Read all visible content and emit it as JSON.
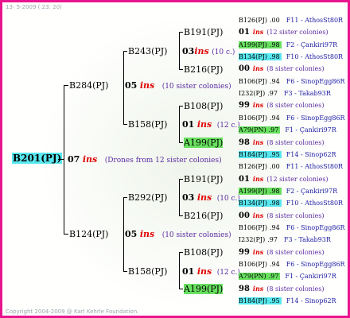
{
  "header": {
    "date": "13- 5-2009 ( 23: 20)"
  },
  "footer": {
    "copyright": "Copyright 2004-2009 @ Karl Kehrle Foundation."
  },
  "root": {
    "name": "B201(PJ)",
    "gen": "07",
    "ins": "ins",
    "note": "(Drones from 12 sister colonies)"
  },
  "upper": {
    "name": "B284(PJ)",
    "gen": "05",
    "ins": "ins",
    "note": "(10 sister colonies)",
    "top": {
      "name": "B243(PJ)",
      "gen": "03",
      "ins": "ins",
      "note": "(10 c.)",
      "a": {
        "name": "B191(PJ)",
        "gen": "01",
        "ins": "ins",
        "note": "(12 c.)"
      },
      "b": {
        "name": "B216(PJ)"
      }
    },
    "bottom": {
      "name": "B158(PJ)",
      "gen": "01",
      "ins": "ins",
      "note": "(12 c.)",
      "a": {
        "name": "B108(PJ)"
      },
      "b": {
        "name": "A199(PJ)"
      }
    }
  },
  "lower": {
    "name": "B124(PJ)",
    "gen": "05",
    "ins": "ins",
    "note": "(10 sister colonies)",
    "top": {
      "name": "B292(PJ)",
      "gen": "03",
      "ins": "ins",
      "note": "(10 c.)",
      "a": {
        "name": "B191(PJ)"
      },
      "b": {
        "name": "B216(PJ)"
      }
    },
    "bottom": {
      "name": "B158(PJ)",
      "gen": "01",
      "ins": "ins",
      "note": "(12 c.)",
      "a": {
        "name": "B108(PJ)"
      },
      "b": {
        "name": "A199(PJ)"
      }
    }
  },
  "right": [
    {
      "a": "B126(PJ)",
      "v": ".00",
      "info": "F11 - AthosSt80R"
    },
    {
      "g": "01",
      "i": "ins",
      "n": "(12 sister colonies)"
    },
    {
      "a": "A199(PJ)",
      "v": ".98",
      "info": "F2 - Çankiri97R",
      "hl": "g"
    },
    {
      "a": "B134(PJ)",
      "v": ".98",
      "info": "F10 - AthosSt80R",
      "hl": "c"
    },
    {
      "g": "00",
      "i": "ins",
      "n": "(8 sister colonies)"
    },
    {
      "a": "B106(PJ)",
      "v": ".94",
      "info": "F6 - SinopEgg86R"
    },
    {
      "a": "I232(PJ)",
      "v": ".97",
      "info": "F3 - Takab93R"
    },
    {
      "g": "99",
      "i": "ins",
      "n": "(8 sister colonies)"
    },
    {
      "a": "B106(PJ)",
      "v": ".94",
      "info": "F6 - SinopEgg86R"
    },
    {
      "a": "A79(PN)",
      "v": ".97",
      "info": "F1 - Çankiri97R",
      "hl": "g"
    },
    {
      "g": "98",
      "i": "ins",
      "n": "(8 sister colonies)"
    },
    {
      "a": "B184(PJ)",
      "v": ".95",
      "info": "F14 - Sinop62R",
      "hl": "c"
    },
    {
      "a": "B126(PJ)",
      "v": ".00",
      "info": "F11 - AthosSt80R"
    },
    {
      "g": "01",
      "i": "ins",
      "n": "(12 sister colonies)"
    },
    {
      "a": "A199(PJ)",
      "v": ".98",
      "info": "F2 - Çankiri97R",
      "hl": "g"
    },
    {
      "a": "B134(PJ)",
      "v": ".98",
      "info": "F10 - AthosSt80R",
      "hl": "c"
    },
    {
      "g": "00",
      "i": "ins",
      "n": "(8 sister colonies)"
    },
    {
      "a": "B106(PJ)",
      "v": ".94",
      "info": "F6 - SinopEgg86R"
    },
    {
      "a": "I232(PJ)",
      "v": ".97",
      "info": "F3 - Takab93R"
    },
    {
      "g": "99",
      "i": "ins",
      "n": "(8 sister colonies)"
    },
    {
      "a": "B106(PJ)",
      "v": ".94",
      "info": "F6 - SinopEgg86R"
    },
    {
      "a": "A79(PN)",
      "v": ".97",
      "info": "F1 - Çankiri97R",
      "hl": "g"
    },
    {
      "g": "98",
      "i": "ins",
      "n": "(8 sister colonies)"
    },
    {
      "a": "B184(PJ)",
      "v": ".95",
      "info": "F14 - Sinop62R",
      "hl": "c"
    }
  ]
}
